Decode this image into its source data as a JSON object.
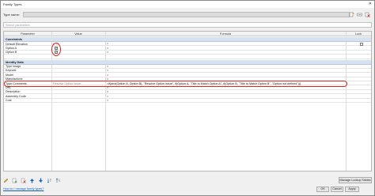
{
  "window": {
    "title": "Family Types",
    "close_glyph": "✕"
  },
  "type_name": {
    "label": "Type name:",
    "value": ""
  },
  "toolbar_icons": [
    "new-type-icon",
    "rename-type-icon",
    "delete-type-icon"
  ],
  "search": {
    "placeholder": "Search parameters"
  },
  "columns": {
    "parameter": "Parameter",
    "value": "Value",
    "formula": "Formula",
    "lock": "Lock"
  },
  "sections": {
    "constraints": "Constraints",
    "identity": "Identity Data"
  },
  "constraint_rows": [
    {
      "name": "Default Elevation",
      "value": "0' 0\"",
      "formula": "="
    },
    {
      "name": "Option A",
      "checked": true,
      "formula": "="
    },
    {
      "name": "Option B",
      "checked": true,
      "formula": "="
    }
  ],
  "identity_rows": [
    {
      "name": "Type Image",
      "formula": "="
    },
    {
      "name": "Keynote",
      "formula": "="
    },
    {
      "name": "Model",
      "formula": "="
    },
    {
      "name": "Manufacturer",
      "formula": "="
    },
    {
      "name": "Type Comments",
      "value": "Resolve Option Issue",
      "formula": "=if(and(Option A, Option B), \"Resolve Option Issue\", if(Option A, \"Title to Match Option A\", if(Option B, \"Title to Match Option B\", \"Option not defined\")))"
    },
    {
      "name": "URL",
      "formula": "="
    },
    {
      "name": "Description",
      "formula": "="
    },
    {
      "name": "Assembly Code",
      "formula": "="
    },
    {
      "name": "Cost",
      "formula": "="
    }
  ],
  "bottom_icons": [
    "edit-icon",
    "new-parameter-icon",
    "delete-parameter-icon",
    "move-up-icon",
    "move-down-icon",
    "sort-ascending-icon",
    "sort-descending-icon"
  ],
  "manage_lookup_label": "Manage Lookup Tables",
  "help_link": "How do I manage family types?",
  "buttons": {
    "ok": "OK",
    "cancel": "Cancel",
    "apply": "Apply"
  },
  "colors": {
    "section_bg": "#d5e2f1",
    "highlight": "#d7261e",
    "link": "#1a5fb4"
  }
}
